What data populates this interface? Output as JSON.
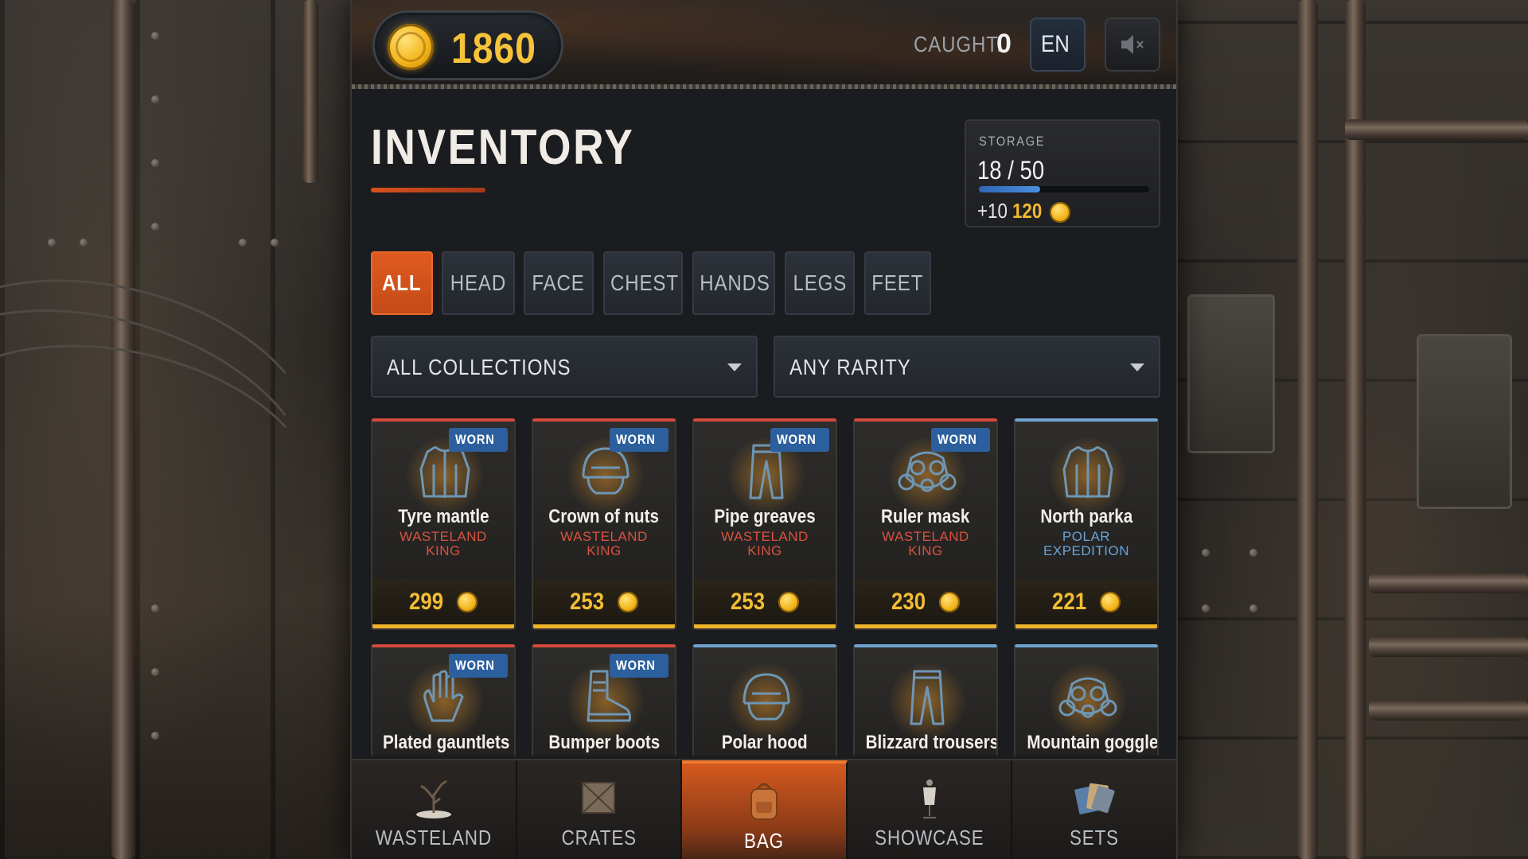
{
  "header": {
    "coins": "1860",
    "caught_label": "CAUGHT:",
    "caught_value": "0",
    "language": "EN"
  },
  "page": {
    "title": "INVENTORY"
  },
  "storage": {
    "label": "STORAGE",
    "count": "18 / 50",
    "fill_fraction": 0.36,
    "expand_amount": "+10",
    "expand_price": "120"
  },
  "tabs": [
    "ALL",
    "HEAD",
    "FACE",
    "CHEST",
    "HANDS",
    "LEGS",
    "FEET"
  ],
  "active_tab": "ALL",
  "filters": {
    "collection": "ALL COLLECTIONS",
    "rarity": "ANY RARITY"
  },
  "items": [
    {
      "name": "Tyre mantle",
      "collection": "WASTELAND KING",
      "price": "299",
      "worn": "WORN",
      "icon": "jacket-icon",
      "rarity_color": "#d34a3c"
    },
    {
      "name": "Crown of nuts",
      "collection": "WASTELAND KING",
      "price": "253",
      "worn": "WORN",
      "icon": "helmet-icon",
      "rarity_color": "#d34a3c"
    },
    {
      "name": "Pipe greaves",
      "collection": "WASTELAND KING",
      "price": "253",
      "worn": "WORN",
      "icon": "trousers-icon",
      "rarity_color": "#d34a3c"
    },
    {
      "name": "Ruler mask",
      "collection": "WASTELAND KING",
      "price": "230",
      "worn": "WORN",
      "icon": "gas-mask-icon",
      "rarity_color": "#d34a3c"
    },
    {
      "name": "North parka",
      "collection": "POLAR EXPEDITION",
      "price": "221",
      "worn": "",
      "icon": "jacket-icon",
      "rarity_color": "#6fa4d2"
    },
    {
      "name": "Plated gauntlets",
      "worn": "WORN",
      "icon": "glove-icon",
      "rarity_color": "#d34a3c"
    },
    {
      "name": "Bumper boots",
      "worn": "WORN",
      "icon": "boot-icon",
      "rarity_color": "#d34a3c"
    },
    {
      "name": "Polar hood",
      "worn": "",
      "icon": "helmet-icon",
      "rarity_color": "#6fa4d2"
    },
    {
      "name": "Blizzard trousers",
      "worn": "",
      "icon": "trousers-icon",
      "rarity_color": "#6fa4d2"
    },
    {
      "name": "Mountain goggles",
      "worn": "",
      "icon": "gas-mask-icon",
      "rarity_color": "#6fa4d2"
    }
  ],
  "nav": [
    {
      "label": "WASTELAND",
      "icon": "dead-tree-icon"
    },
    {
      "label": "CRATES",
      "icon": "crate-icon"
    },
    {
      "label": "BAG",
      "icon": "backpack-icon"
    },
    {
      "label": "SHOWCASE",
      "icon": "mannequin-icon"
    },
    {
      "label": "SETS",
      "icon": "cards-icon"
    }
  ],
  "active_nav": "BAG",
  "colors": {
    "accent_orange": "#d9521c",
    "coin_gold": "#f2b92e",
    "worn_badge": "#2c5f9e",
    "rare_red": "#d34a3c",
    "polar_blue": "#6fa4d2"
  }
}
